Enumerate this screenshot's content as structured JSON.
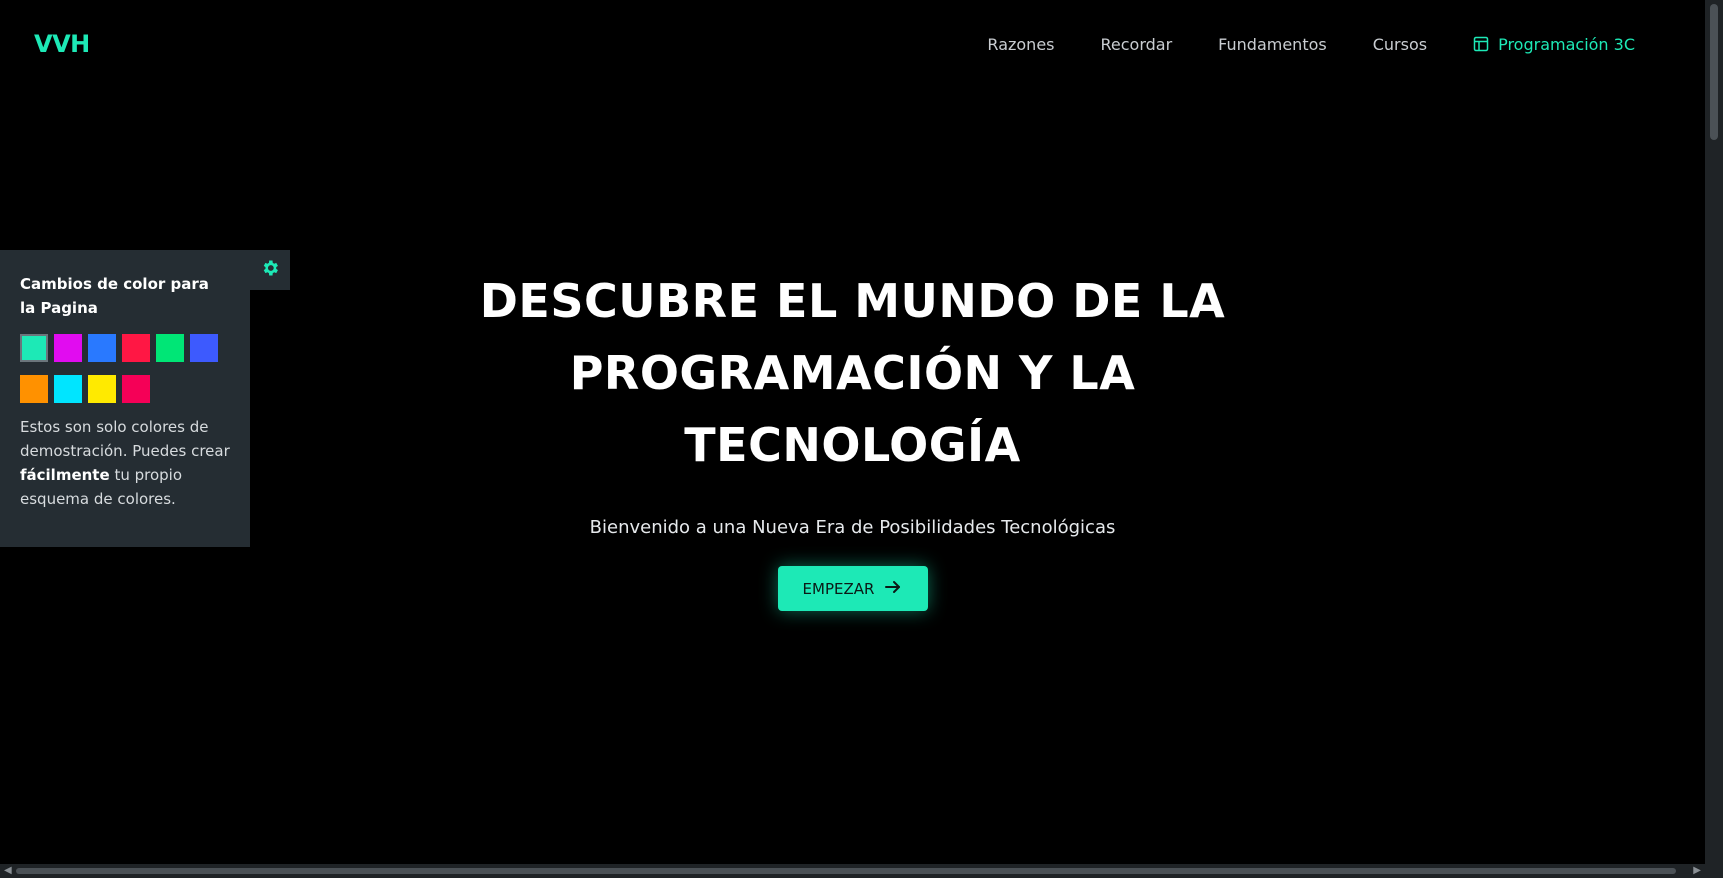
{
  "header": {
    "logo": "VVH",
    "nav": [
      {
        "label": "Razones"
      },
      {
        "label": "Recordar"
      },
      {
        "label": "Fundamentos"
      },
      {
        "label": "Cursos"
      },
      {
        "label": "Programación 3C",
        "active": true,
        "icon": "layout-icon"
      }
    ]
  },
  "color_panel": {
    "title": "Cambios de color para la Pagina",
    "gear_icon": "gear-icon",
    "swatches": [
      "#1de9b6",
      "#e10cf0",
      "#2979ff",
      "#ff1744",
      "#00e676",
      "#3d5afe",
      "#ff9100",
      "#00e5ff",
      "#ffea00",
      "#f50057"
    ],
    "selected_index": 0,
    "text_before": "Estos son solo colores de demostración. Puedes crear",
    "text_bold": "fácilmente",
    "text_after": "tu propio esquema de colores."
  },
  "hero": {
    "title": "DESCUBRE EL MUNDO DE LA PROGRAMACIÓN Y LA TECNOLOGÍA",
    "subtitle": "Bienvenido a una Nueva Era de Posibilidades Tecnológicas",
    "cta_label": "EMPEZAR",
    "cta_icon": "arrow-right-icon"
  },
  "colors": {
    "accent": "#1de9b6",
    "background": "#000000",
    "panel": "#252d33"
  }
}
